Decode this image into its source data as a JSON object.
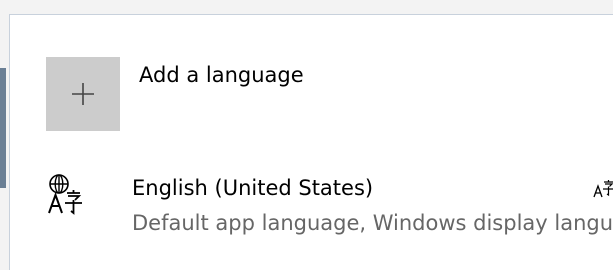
{
  "settings": {
    "heading_partial": "",
    "add_language": {
      "label": "Add a language",
      "icon": "plus-icon"
    },
    "languages": [
      {
        "name": "English (United States)",
        "description": "Default app language, Windows display language",
        "icon": "language-icon",
        "feature_icon": "display-language-icon"
      }
    ]
  },
  "colors": {
    "tile": "#cccccc",
    "secondary_text": "#666666"
  }
}
